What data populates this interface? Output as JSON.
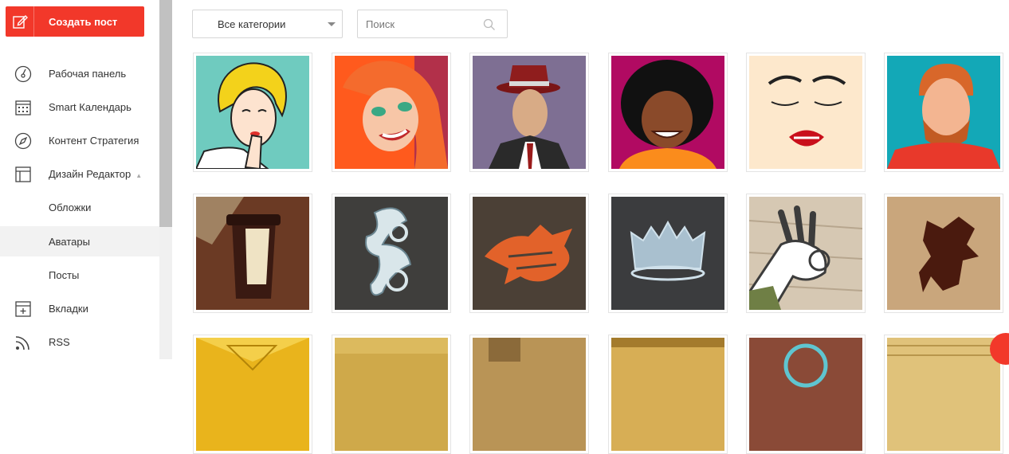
{
  "sidebar": {
    "create_label": "Создать пост",
    "items": [
      {
        "label": "Рабочая панель",
        "icon": "dashboard-icon"
      },
      {
        "label": "Smart Календарь",
        "icon": "calendar-icon"
      },
      {
        "label": "Контент Стратегия",
        "icon": "compass-icon"
      },
      {
        "label": "Дизайн Редактор",
        "icon": "layout-icon"
      },
      {
        "label": "Обложки"
      },
      {
        "label": "Аватары",
        "active": true
      },
      {
        "label": "Посты"
      },
      {
        "label": "Вкладки",
        "icon": "tabs-icon"
      },
      {
        "label": "RSS",
        "icon": "rss-icon"
      }
    ]
  },
  "toolbar": {
    "category_value": "Все категории",
    "search_placeholder": "Поиск"
  },
  "gallery": {
    "rows": [
      [
        "pop-art-woman-thinking",
        "pop-art-redhead-smiling",
        "man-in-fedora",
        "afro-man-smiling",
        "closed-eyes-red-lips",
        "ginger-bearded-man"
      ],
      [
        "coffee-cup-burlap",
        "silver-ornament-swirl",
        "orange-dragon-rust",
        "crown-on-dark-metal",
        "ok-hand-sign-wood",
        "dragon-silhouette-parchment"
      ],
      [
        "gold-geometric",
        "gold-texture",
        "gold-rust-texture",
        "gold-wood",
        "brick-wall-badge",
        "gold-weave"
      ]
    ]
  },
  "colors": {
    "accent": "#f2382a",
    "sidebar_active_bg": "#f2f2f2"
  }
}
